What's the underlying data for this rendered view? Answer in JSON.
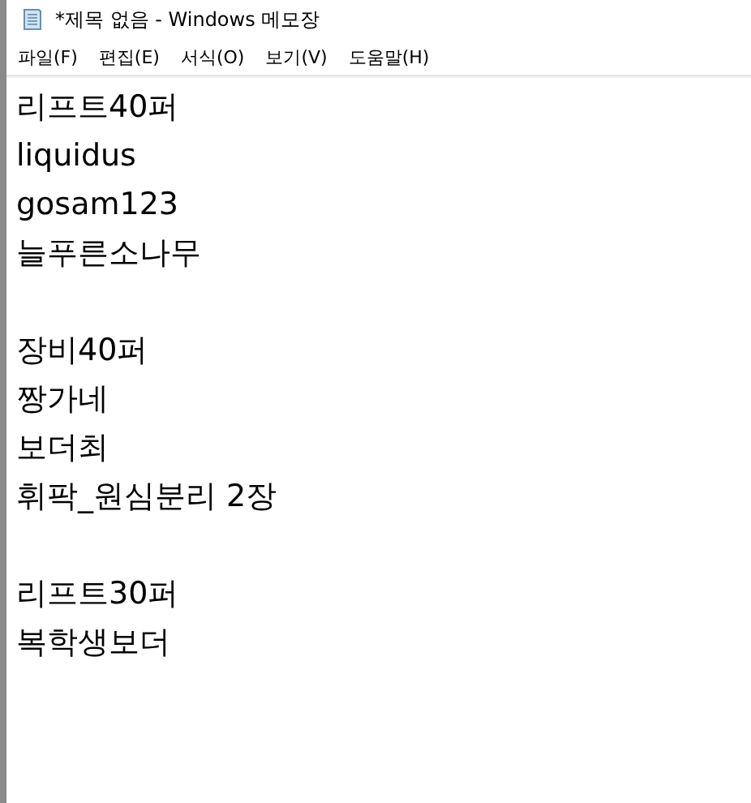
{
  "window": {
    "title": "*제목 없음 - Windows 메모장"
  },
  "menu": [
    "파일(F)",
    "편집(E)",
    "서식(O)",
    "보기(V)",
    "도움말(H)"
  ],
  "editor": {
    "paragraphs": [
      [
        "리프트40퍼",
        "liquidus",
        "gosam123",
        "늘푸른소나무"
      ],
      [
        "장비40퍼",
        "짱가네",
        "보더최",
        "휘팍_원심분리 2장"
      ],
      [
        "리프트30퍼",
        "복학생보더"
      ]
    ]
  }
}
